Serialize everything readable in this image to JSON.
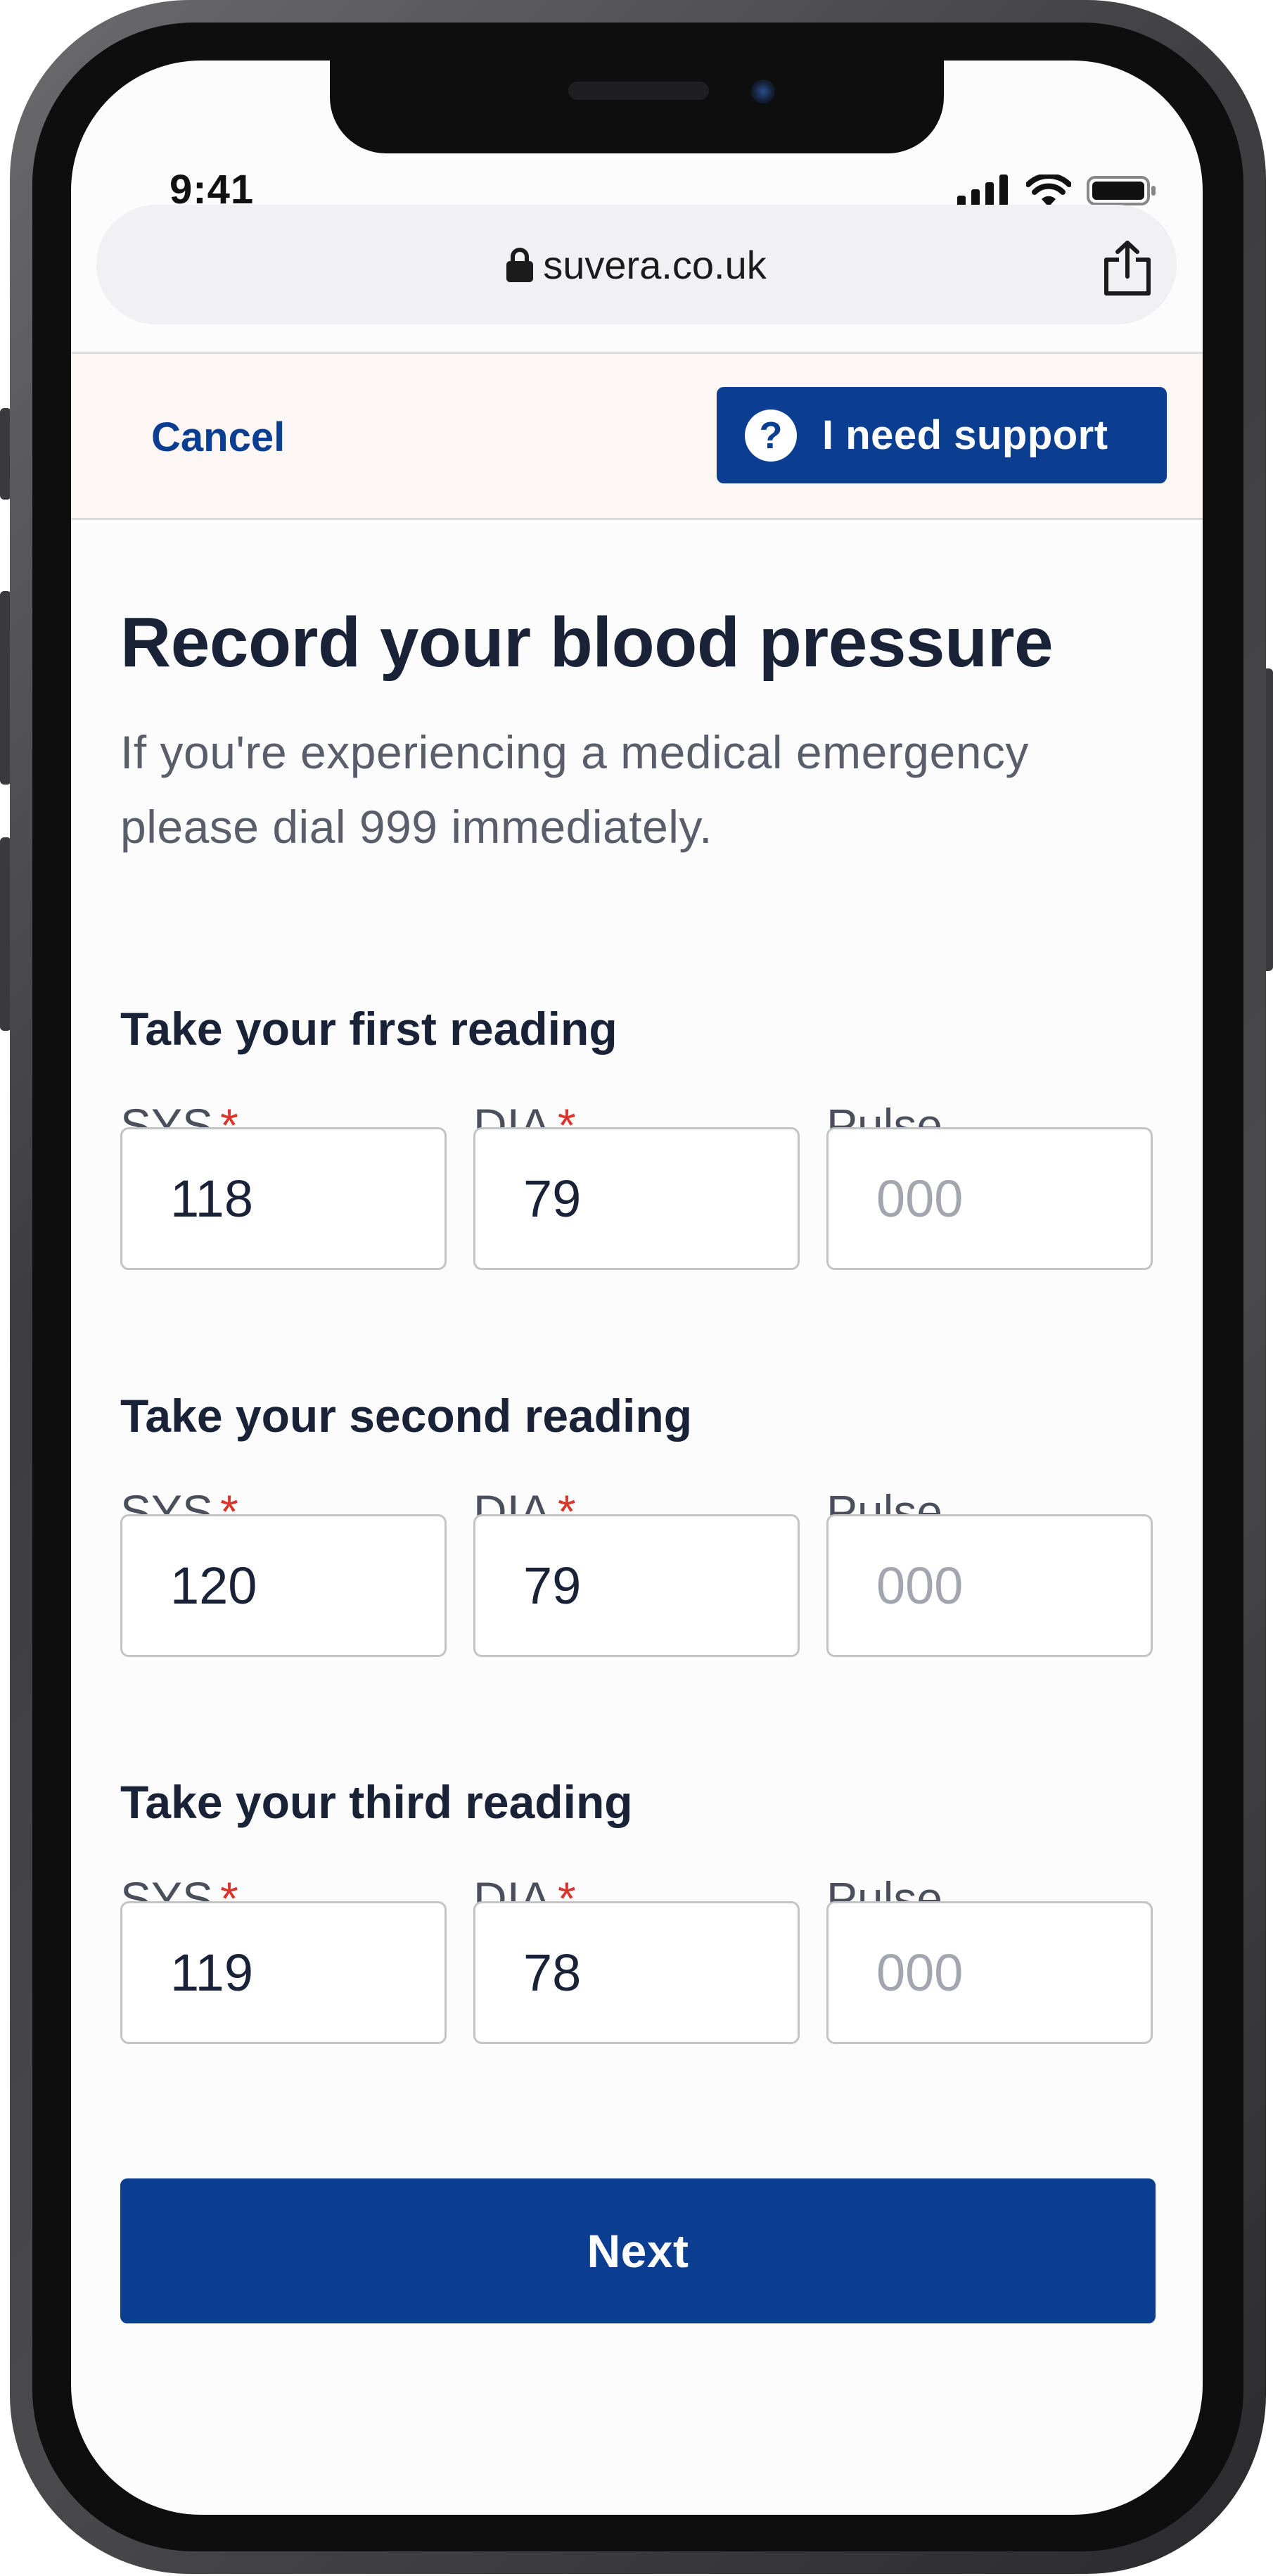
{
  "status_bar": {
    "time": "9:41"
  },
  "browser": {
    "url": "suvera.co.uk"
  },
  "header": {
    "cancel_label": "Cancel",
    "support_label": "I need support",
    "support_icon": "?"
  },
  "page": {
    "title": "Record your blood pressure",
    "subtitle": "If you're experiencing a medical emergency please dial 999 immediately."
  },
  "readings": [
    {
      "heading": "Take your first reading",
      "sys_label": "SYS",
      "dia_label": "DIA",
      "pulse_label": "Pulse",
      "sys": "118",
      "dia": "79",
      "pulse": "",
      "pulse_placeholder": "000",
      "required_mark": "*"
    },
    {
      "heading": "Take your second reading",
      "sys_label": "SYS",
      "dia_label": "DIA",
      "pulse_label": "Pulse",
      "sys": "120",
      "dia": "79",
      "pulse": "",
      "pulse_placeholder": "000",
      "required_mark": "*"
    },
    {
      "heading": "Take your third reading",
      "sys_label": "SYS",
      "dia_label": "DIA",
      "pulse_label": "Pulse",
      "sys": "119",
      "dia": "78",
      "pulse": "",
      "pulse_placeholder": "000",
      "required_mark": "*"
    }
  ],
  "actions": {
    "next_label": "Next"
  },
  "colors": {
    "primary": "#0b3d91",
    "required": "#d9362b",
    "title": "#1a2238"
  }
}
